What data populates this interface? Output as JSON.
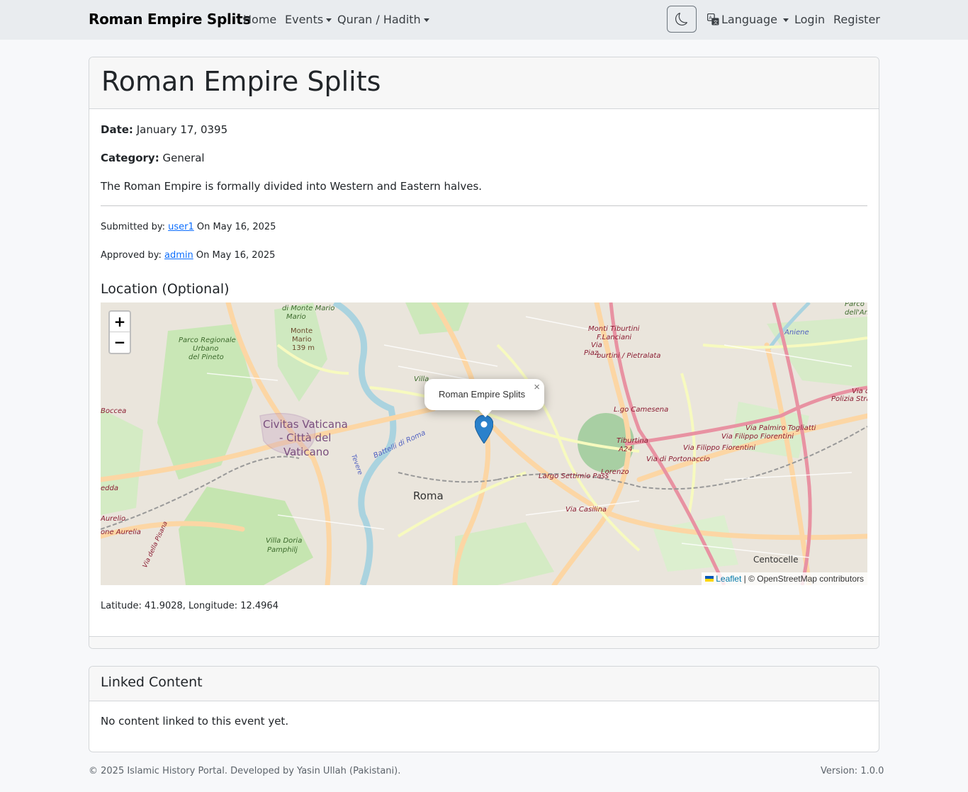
{
  "nav": {
    "brand": "Roman Empire Splits",
    "home": "Home",
    "events": "Events",
    "quran_hadith": "Quran / Hadith",
    "language": "Language",
    "login": "Login",
    "register": "Register"
  },
  "event": {
    "title": "Roman Empire Splits",
    "date_label": "Date:",
    "date_value": "January 17, 0395",
    "category_label": "Category:",
    "category_value": "General",
    "description": "The Roman Empire is formally divided into Western and Eastern halves.",
    "submitted_prefix": "Submitted by:",
    "submitted_user": "user1",
    "submitted_on": "On May 16, 2025",
    "approved_prefix": "Approved by:",
    "approved_user": "admin",
    "approved_on": "On May 16, 2025"
  },
  "location": {
    "heading": "Location (Optional)",
    "popup": "Roman Empire Splits",
    "popup_close": "×",
    "zoom_in": "+",
    "zoom_out": "−",
    "attribution_leaflet": "Leaflet",
    "attribution_rest": " | © OpenStreetMap contributors",
    "coords": "Latitude: 41.9028, Longitude: 12.4964",
    "map_labels": {
      "civitas": "Civitas Vaticana",
      "citta": "- Città del",
      "vaticano": "Vaticano",
      "roma": "Roma",
      "centocelle": "Centocelle",
      "villa_doria": "Villa Doria",
      "pamphilj": "Pamphilj",
      "parco": "Parco Regionale",
      "urbano": "Urbano",
      "pineto": "del Pineto",
      "monte_mario": "di Monte Mario",
      "mario": "Mario",
      "monte": "Monte",
      "mario2": "Mario",
      "m139": "139 m",
      "tiburtina": "Tiburtina",
      "a24": "A24",
      "lgo": "L.go Camesena",
      "casilina": "Via Casilina",
      "settimio": "Largo Settimio Pass",
      "portonaccio": "Via di Portonaccio",
      "fiorentini": "Via Filippo Fiorentini",
      "fiorentini2": "Via Filippo Fiorentini",
      "togliatti": "Via Palmiro Togliatti",
      "polizia": "Polizia Strada",
      "lorenzo": "Lorenzo",
      "battelli": "Battelli di Roma",
      "aurelia": "Aurelio",
      "aurelia2": "one Aurelia",
      "edda": "edda",
      "parco_r": "Parco",
      "aniene": "dell'An",
      "aniene2": "Aniene",
      "tiburtini": "Monti Tiburtini",
      "flanciani": "F.Lanciani",
      "pietralata": "burtini / Pietralata",
      "piaz": "Piaz",
      "via": "Via",
      "villa": "Villa",
      "boccea": "Boccea",
      "pisana": "Via della Pisana",
      "tevere": "Tevere",
      "via_d": "Via d"
    }
  },
  "linked": {
    "heading": "Linked Content",
    "empty": "No content linked to this event yet."
  },
  "footer": {
    "copyright": "© 2025 Islamic History Portal. Developed by Yasin Ullah (Pakistani).",
    "version": "Version: 1.0.0"
  }
}
